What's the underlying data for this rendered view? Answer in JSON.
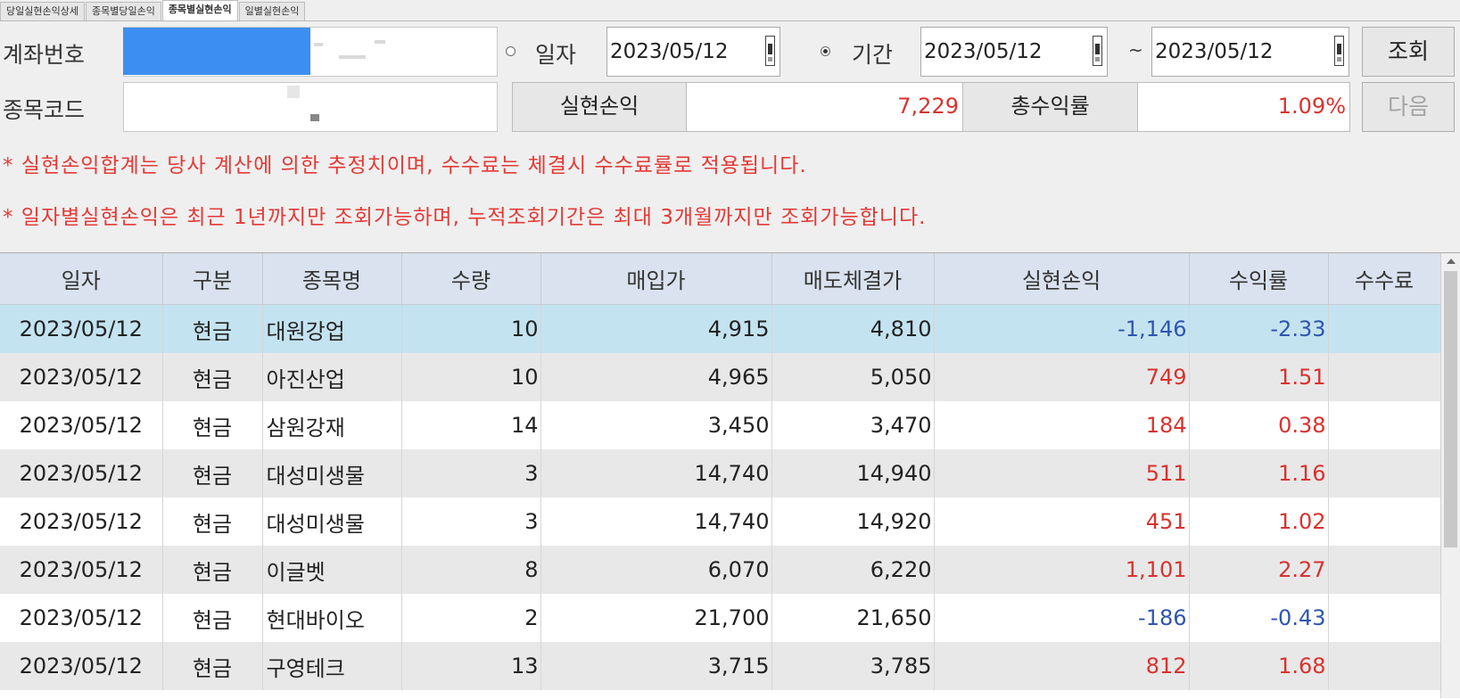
{
  "tabs": [
    {
      "label": "당일실현손익상세",
      "active": false
    },
    {
      "label": "종목별당일손익",
      "active": false
    },
    {
      "label": "종목별실현손익",
      "active": true
    },
    {
      "label": "일별실현손익",
      "active": false
    }
  ],
  "form": {
    "account_label": "계좌번호",
    "stock_code_label": "종목코드",
    "radio_date_label": "일자",
    "radio_period_label": "기간",
    "date_value": "2023/05/12",
    "period_start": "2023/05/12",
    "period_end": "2023/05/12",
    "tilde": "~",
    "query_button": "조회",
    "next_button": "다음"
  },
  "summary": {
    "realized_label": "실현손익",
    "realized_value": "7,229",
    "return_label": "총수익률",
    "return_value": "1.09%"
  },
  "notices": [
    "* 실현손익합계는 당사 계산에 의한 추정치이며, 수수료는 체결시 수수료률로 적용됩니다.",
    "* 일자별실현손익은 최근 1년까지만 조회가능하며, 누적조회기간은 최대 3개월까지만 조회가능합니다."
  ],
  "table": {
    "headers": [
      "일자",
      "구분",
      "종목명",
      "수량",
      "매입가",
      "매도체결가",
      "실현손익",
      "수익률",
      "수수료"
    ],
    "rows": [
      [
        "2023/05/12",
        "현금",
        "대원강업",
        "10",
        "4,915",
        "4,810",
        "-1,146",
        "-2.33",
        ""
      ],
      [
        "2023/05/12",
        "현금",
        "아진산업",
        "10",
        "4,965",
        "5,050",
        "749",
        "1.51",
        ""
      ],
      [
        "2023/05/12",
        "현금",
        "삼원강재",
        "14",
        "3,450",
        "3,470",
        "184",
        "0.38",
        ""
      ],
      [
        "2023/05/12",
        "현금",
        "대성미생물",
        "3",
        "14,740",
        "14,940",
        "511",
        "1.16",
        ""
      ],
      [
        "2023/05/12",
        "현금",
        "대성미생물",
        "3",
        "14,740",
        "14,920",
        "451",
        "1.02",
        ""
      ],
      [
        "2023/05/12",
        "현금",
        "이글벳",
        "8",
        "6,070",
        "6,220",
        "1,101",
        "2.27",
        ""
      ],
      [
        "2023/05/12",
        "현금",
        "현대바이오",
        "2",
        "21,700",
        "21,650",
        "-186",
        "-0.43",
        ""
      ],
      [
        "2023/05/12",
        "현금",
        "구영테크",
        "13",
        "3,715",
        "3,785",
        "812",
        "1.68",
        ""
      ]
    ]
  },
  "colors": {
    "negative": "#2f55b0",
    "positive": "#d9322e",
    "notice": "#e53935",
    "selected_row": "#c4e3f0",
    "header_bg": "#d9e2ee"
  }
}
